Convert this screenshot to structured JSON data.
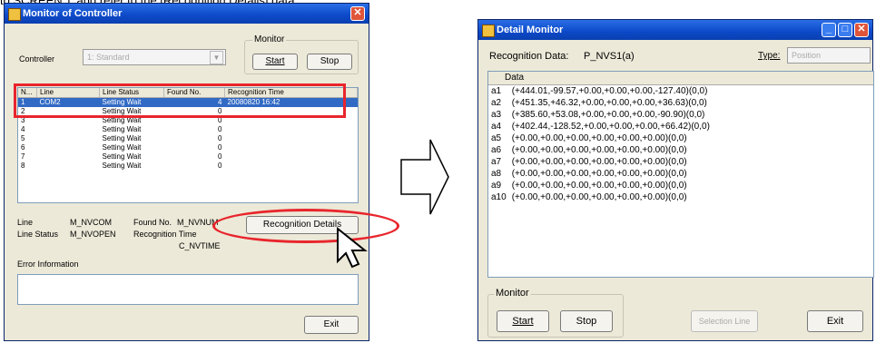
{
  "caption": "to SCREEN”), and refer to the [Recognition Details] data.",
  "left_window": {
    "title": "Monitor of Controller",
    "controller_label": "Controller",
    "controller_value": "1: Standard",
    "monitor_label": "Monitor",
    "start_label": "Start",
    "stop_label": "Stop",
    "columns": [
      "N...",
      "Line",
      "Line Status",
      "Found No.",
      "Recognition Time"
    ],
    "rows": [
      {
        "n": "1",
        "line": "COM2",
        "status": "Setting Wait",
        "found": "4",
        "time": "20080820 16:42"
      },
      {
        "n": "2",
        "line": "",
        "status": "Setting Wait",
        "found": "0",
        "time": ""
      },
      {
        "n": "3",
        "line": "",
        "status": "Setting Wait",
        "found": "0",
        "time": ""
      },
      {
        "n": "4",
        "line": "",
        "status": "Setting Wait",
        "found": "0",
        "time": ""
      },
      {
        "n": "5",
        "line": "",
        "status": "Setting Wait",
        "found": "0",
        "time": ""
      },
      {
        "n": "6",
        "line": "",
        "status": "Setting Wait",
        "found": "0",
        "time": ""
      },
      {
        "n": "7",
        "line": "",
        "status": "Setting Wait",
        "found": "0",
        "time": ""
      },
      {
        "n": "8",
        "line": "",
        "status": "Setting Wait",
        "found": "0",
        "time": ""
      }
    ],
    "line_label": "Line",
    "line_var": "M_NVCOM",
    "found_label": "Found No.",
    "found_var": "M_NVNUM",
    "linestatus_label": "Line Status",
    "linestatus_var": "M_NVOPEN",
    "rectime_label": "Recognition Time",
    "rectime_var": "C_NVTIME",
    "details_button": "Recognition Details",
    "error_label": "Error Information",
    "exit_label": "Exit"
  },
  "right_window": {
    "title": "Detail Monitor",
    "recog_label": "Recognition Data:",
    "recog_var": "P_NVS1(a)",
    "type_label": "Type:",
    "type_value": "Position",
    "data_header": "Data",
    "data_rows": [
      {
        "idx": "a1",
        "val": "(+444.01,-99.57,+0.00,+0.00,+0.00,-127.40)(0,0)"
      },
      {
        "idx": "a2",
        "val": "(+451.35,+46.32,+0.00,+0.00,+0.00,+36.63)(0,0)"
      },
      {
        "idx": "a3",
        "val": "(+385.60,+53.08,+0.00,+0.00,+0.00,-90.90)(0,0)"
      },
      {
        "idx": "a4",
        "val": "(+402.44,-128.52,+0.00,+0.00,+0.00,+66.42)(0,0)"
      },
      {
        "idx": "a5",
        "val": "(+0.00,+0.00,+0.00,+0.00,+0.00,+0.00)(0,0)"
      },
      {
        "idx": "a6",
        "val": "(+0.00,+0.00,+0.00,+0.00,+0.00,+0.00)(0,0)"
      },
      {
        "idx": "a7",
        "val": "(+0.00,+0.00,+0.00,+0.00,+0.00,+0.00)(0,0)"
      },
      {
        "idx": "a8",
        "val": "(+0.00,+0.00,+0.00,+0.00,+0.00,+0.00)(0,0)"
      },
      {
        "idx": "a9",
        "val": "(+0.00,+0.00,+0.00,+0.00,+0.00,+0.00)(0,0)"
      },
      {
        "idx": "a10",
        "val": "(+0.00,+0.00,+0.00,+0.00,+0.00,+0.00)(0,0)"
      }
    ],
    "monitor_label": "Monitor",
    "start_label": "Start",
    "stop_label": "Stop",
    "selection_label": "Selection Line",
    "exit_label": "Exit"
  },
  "colors": {
    "annotation_red": "#e8252c",
    "title_blue": "#0c49c8",
    "selection_blue": "#316ac5"
  }
}
